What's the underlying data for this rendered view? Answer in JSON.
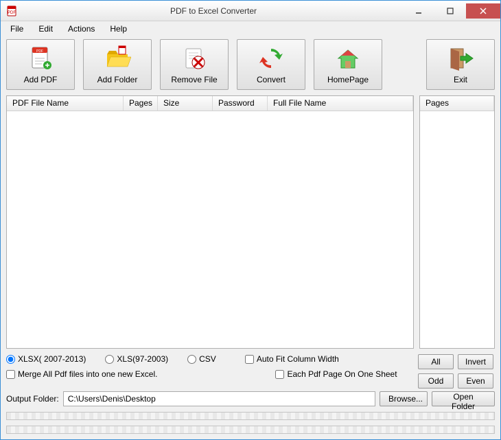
{
  "window": {
    "title": "PDF to Excel Converter"
  },
  "menu": {
    "file": "File",
    "edit": "Edit",
    "actions": "Actions",
    "help": "Help"
  },
  "toolbar": {
    "add_pdf": "Add PDF",
    "add_folder": "Add Folder",
    "remove_file": "Remove File",
    "convert": "Convert",
    "homepage": "HomePage",
    "exit": "Exit"
  },
  "columns": {
    "pdf_file_name": "PDF File Name",
    "pages": "Pages",
    "size": "Size",
    "password": "Password",
    "full_file_name": "Full File Name"
  },
  "pages_panel": {
    "header": "Pages"
  },
  "format": {
    "xlsx": "XLSX( 2007-2013)",
    "xls": "XLS(97-2003)",
    "csv": "CSV",
    "selected": "xlsx"
  },
  "options": {
    "auto_fit": "Auto Fit Column Width",
    "merge_all": "Merge All Pdf files into one new Excel.",
    "each_page": "Each Pdf Page On One Sheet"
  },
  "buttons": {
    "all": "All",
    "invert": "Invert",
    "odd": "Odd",
    "even": "Even",
    "browse": "Browse...",
    "open_folder": "Open Folder"
  },
  "output": {
    "label": "Output Folder:",
    "path": "C:\\Users\\Denis\\Desktop"
  }
}
